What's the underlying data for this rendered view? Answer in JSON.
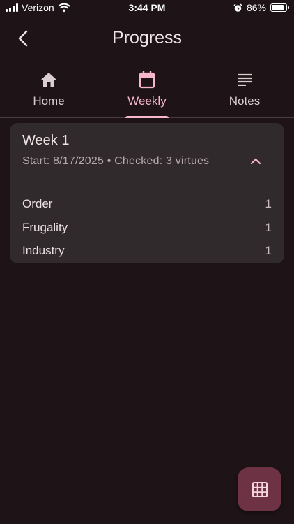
{
  "status_bar": {
    "carrier": "Verizon",
    "time": "3:44 PM",
    "battery": "86%",
    "battery_level": 0.86
  },
  "header": {
    "title": "Progress"
  },
  "tabs": [
    {
      "label": "Home",
      "icon": "home-icon"
    },
    {
      "label": "Weekly",
      "icon": "calendar-icon"
    },
    {
      "label": "Notes",
      "icon": "notes-icon"
    }
  ],
  "active_tab": "Weekly",
  "week": {
    "title": "Week 1",
    "subtitle": "Start: 8/17/2025 • Checked: 3 virtues",
    "virtues": [
      {
        "name": "Order",
        "count": "1"
      },
      {
        "name": "Frugality",
        "count": "1"
      },
      {
        "name": "Industry",
        "count": "1"
      }
    ]
  },
  "colors": {
    "background": "#1e1417",
    "accent": "#f7b6cc",
    "card": "#312a2c",
    "fab": "#6e3245"
  }
}
